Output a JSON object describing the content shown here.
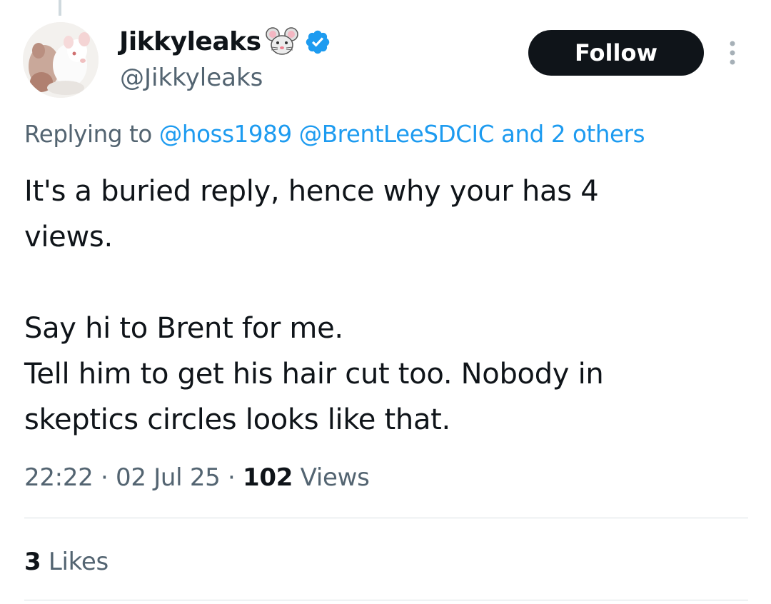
{
  "author": {
    "display_name": "Jikkyleaks",
    "handle": "@Jikkyleaks",
    "name_emoji": "mouse-face-icon",
    "verified_icon": "verified-badge-icon",
    "verified_color": "#1d9bf0"
  },
  "follow_button": {
    "label": "Follow",
    "background": "#0f1419",
    "text_color": "#ffffff"
  },
  "more_button": {
    "icon": "more-vertical-icon"
  },
  "reply_context": {
    "prefix": "Replying to",
    "mentions": [
      "@hoss1989",
      "@BrentLeeSDCIC"
    ],
    "suffix": "and 2 others"
  },
  "tweet": {
    "lines": [
      "It's a buried reply, hence why your has 4",
      "views.",
      "Say hi to Brent for me.",
      "Tell him to get his hair cut too. Nobody in",
      "skeptics circles looks like that."
    ]
  },
  "meta": {
    "time": "22:22",
    "separator": "·",
    "date": "02 Jul 25",
    "views_count": "102",
    "views_label": "Views"
  },
  "engagement": {
    "likes_count": "3",
    "likes_label": "Likes"
  },
  "colors": {
    "text_primary": "#0f1419",
    "text_secondary": "#536471",
    "link": "#1d9bf0",
    "divider": "#d8dfe3"
  }
}
